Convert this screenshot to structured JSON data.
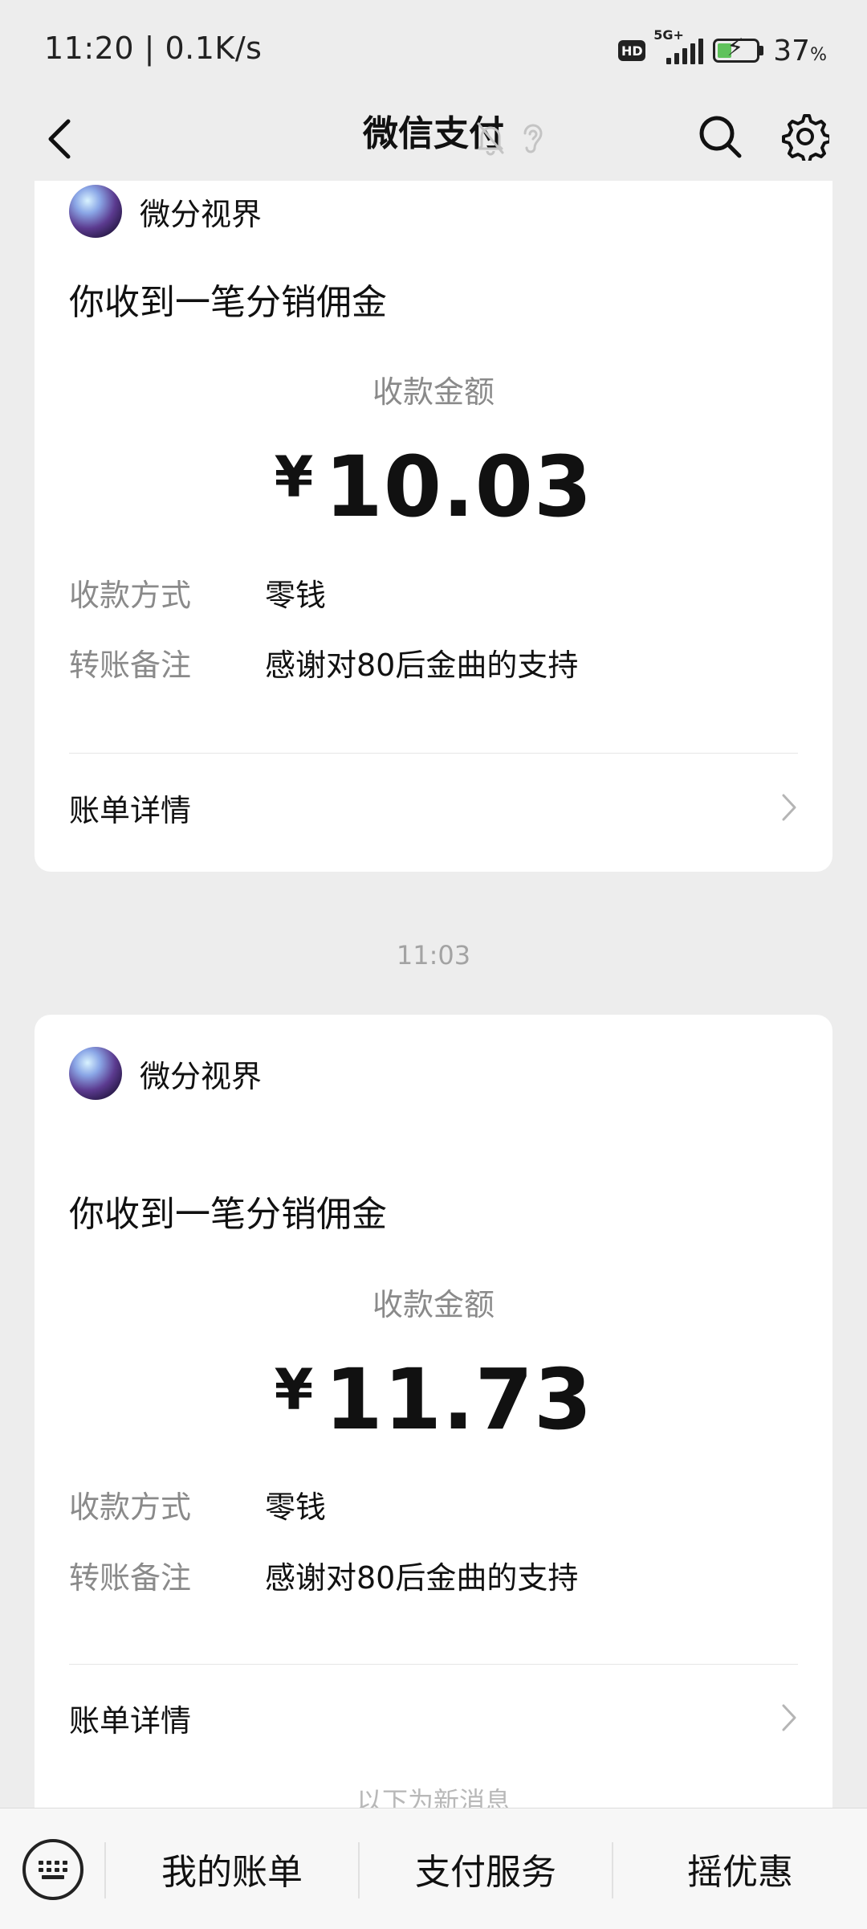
{
  "status_bar": {
    "time": "11:20",
    "net_speed": "0.1K/s",
    "hd": "HD",
    "network": "5G+",
    "battery_pct": "37",
    "battery_unit": "%",
    "battery_level": 0.37
  },
  "nav": {
    "title": "微信支付"
  },
  "messages": [
    {
      "merchant": "微分视界",
      "headline": "你收到一笔分销佣金",
      "amount_label": "收款金额",
      "currency": "¥",
      "amount": "10.03",
      "method_label": "收款方式",
      "method_value": "零钱",
      "note_label": "转账备注",
      "note_value": "感谢对80后金曲的支持",
      "detail_label": "账单详情"
    },
    {
      "timestamp": "11:03",
      "merchant": "微分视界",
      "headline": "你收到一笔分销佣金",
      "amount_label": "收款金额",
      "currency": "¥",
      "amount": "11.73",
      "method_label": "收款方式",
      "method_value": "零钱",
      "note_label": "转账备注",
      "note_value": "感谢对80后金曲的支持",
      "detail_label": "账单详情"
    }
  ],
  "new_messages_hint": "以下为新消息",
  "bottom_menu": {
    "items": [
      "我的账单",
      "支付服务",
      "摇优惠"
    ]
  },
  "icons": {
    "back": "back-arrow-icon",
    "mute": "bell-off-icon",
    "ear": "ear-icon",
    "search": "search-icon",
    "settings": "gear-icon",
    "keyboard": "keyboard-icon",
    "chevron": "chevron-right-icon"
  }
}
